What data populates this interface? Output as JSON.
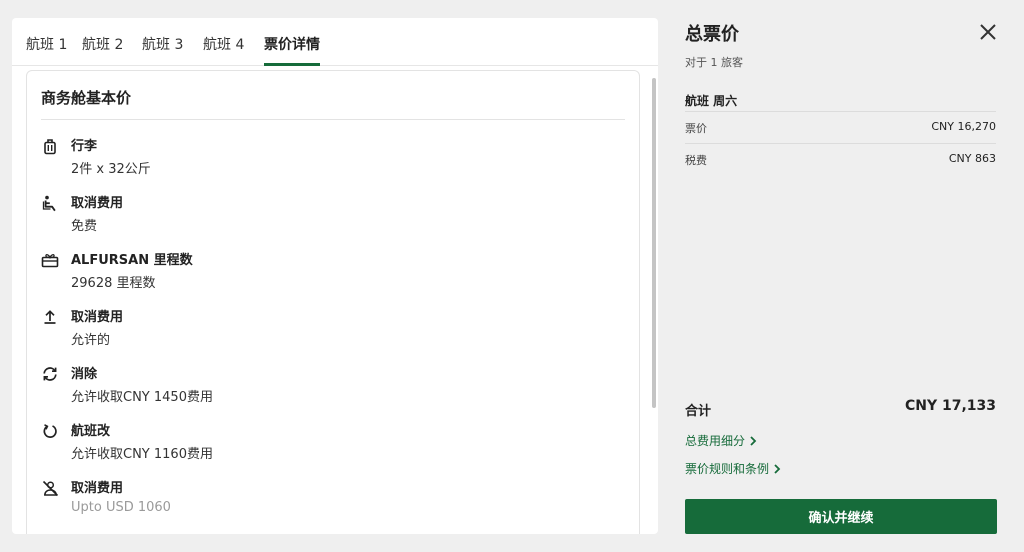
{
  "tabs": [
    {
      "label": "航班 1"
    },
    {
      "label": "航班 2"
    },
    {
      "label": "航班 3"
    },
    {
      "label": "航班 4"
    },
    {
      "label": "票价详情",
      "active": true
    }
  ],
  "fare_card": {
    "title": "商务舱基本价",
    "features": [
      {
        "icon": "luggage-icon",
        "title": "行李",
        "value": "2件 x 32公斤"
      },
      {
        "icon": "seat-icon",
        "title": "取消费用",
        "value": "免费"
      },
      {
        "icon": "gift-icon",
        "title": "ALFURSAN 里程数",
        "value": "29628 里程数"
      },
      {
        "icon": "upload-icon",
        "title": "取消费用",
        "value": "允许的"
      },
      {
        "icon": "refresh-icon",
        "title": "消除",
        "value": "允许收取CNY 1450费用"
      },
      {
        "icon": "rotate-icon",
        "title": "航班改",
        "value": "允许收取CNY 1160费用"
      },
      {
        "icon": "no-show-icon",
        "title": "取消费用",
        "value": "Upto USD 1060"
      }
    ]
  },
  "summary": {
    "title": "总票价",
    "subtitle": "对于 1 旅客",
    "section_title": "航班 周六",
    "rows": [
      {
        "label": "票价",
        "value": "CNY 16,270"
      },
      {
        "label": "税费",
        "value": "CNY 863"
      }
    ],
    "total_label": "合计",
    "total_value": "CNY 17,133",
    "links": [
      {
        "label": "总费用细分"
      },
      {
        "label": "票价规则和条例"
      }
    ],
    "confirm_label": "确认并继续"
  },
  "colors": {
    "accent": "#166b3a",
    "background": "#efefef"
  }
}
